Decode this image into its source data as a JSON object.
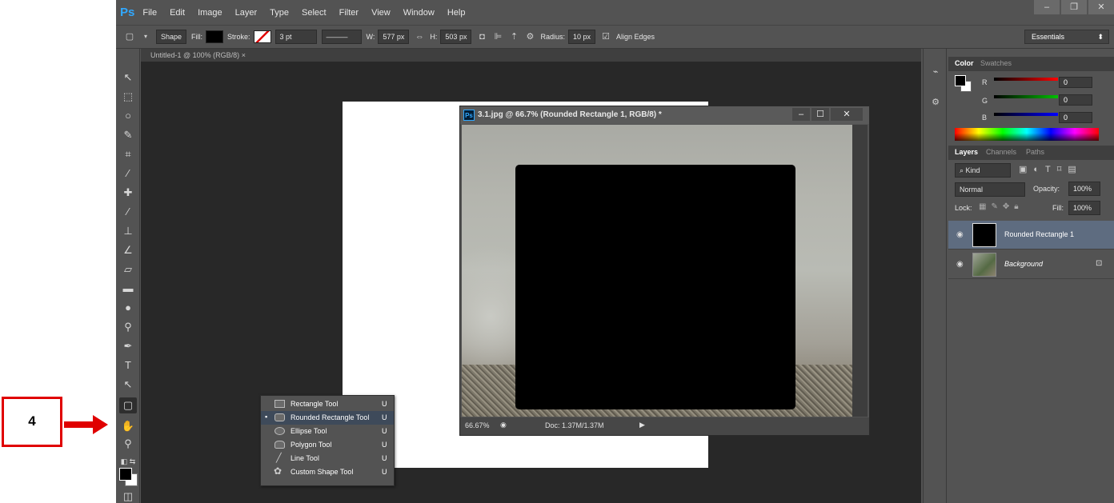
{
  "app": {
    "logo": "Ps",
    "menu": [
      "File",
      "Edit",
      "Image",
      "Layer",
      "Type",
      "Select",
      "Filter",
      "View",
      "Window",
      "Help"
    ]
  },
  "window_controls": {
    "minimize": "–",
    "restore": "❐",
    "close": "✕"
  },
  "options": {
    "mode": "Shape",
    "fill_label": "Fill:",
    "stroke_label": "Stroke:",
    "stroke_width": "3 pt",
    "w_label": "W:",
    "w_value": "577 px",
    "h_label": "H:",
    "h_value": "503 px",
    "radius_label": "Radius:",
    "radius_value": "10 px",
    "align_edges": "Align Edges",
    "workspace": "Essentials"
  },
  "document": {
    "tab_title": "Untitled-1 @ 100% (RGB/8)"
  },
  "float_window": {
    "icon": "Ps",
    "title": "3.1.jpg @ 66.7% (Rounded Rectangle 1, RGB/8) *",
    "zoom": "66.67%",
    "doc_info": "Doc: 1.37M/1.37M"
  },
  "color_panel": {
    "tabs": [
      "Color",
      "Swatches"
    ],
    "channels": [
      {
        "label": "R",
        "value": "0",
        "color": "#ff0000"
      },
      {
        "label": "G",
        "value": "0",
        "color": "#00c000"
      },
      {
        "label": "B",
        "value": "0",
        "color": "#0000ff"
      }
    ]
  },
  "layers_panel": {
    "tabs": [
      "Layers",
      "Channels",
      "Paths"
    ],
    "filter": "Kind",
    "blend_mode": "Normal",
    "opacity_label": "Opacity:",
    "opacity_value": "100%",
    "lock_label": "Lock:",
    "fill_label": "Fill:",
    "fill_value": "100%",
    "layers": [
      {
        "name": "Rounded Rectangle 1",
        "selected": true
      },
      {
        "name": "Background",
        "locked": true
      }
    ]
  },
  "tool_flyout": {
    "items": [
      {
        "label": "Rectangle Tool",
        "key": "U",
        "icon": "rectangle-icon"
      },
      {
        "label": "Rounded Rectangle Tool",
        "key": "U",
        "icon": "rounded-rectangle-icon",
        "selected": true
      },
      {
        "label": "Ellipse Tool",
        "key": "U",
        "icon": "ellipse-icon"
      },
      {
        "label": "Polygon Tool",
        "key": "U",
        "icon": "polygon-icon"
      },
      {
        "label": "Line Tool",
        "key": "U",
        "icon": "line-icon"
      },
      {
        "label": "Custom Shape Tool",
        "key": "U",
        "icon": "custom-shape-icon"
      }
    ]
  },
  "annotation": {
    "step": "4",
    "color": "#e00000"
  }
}
